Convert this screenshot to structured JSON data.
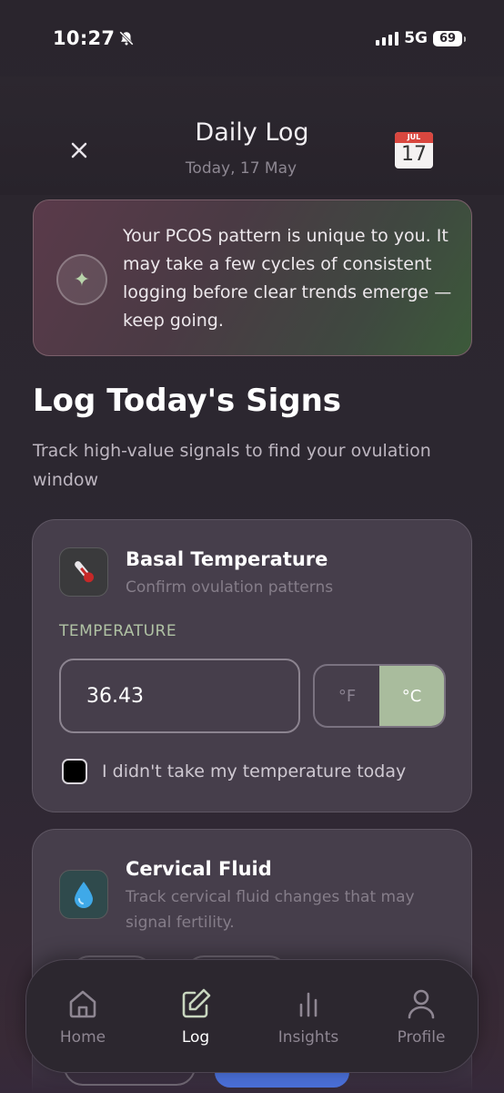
{
  "status_bar": {
    "time": "10:27",
    "network": "5G",
    "battery": "69"
  },
  "header": {
    "title": "Daily Log",
    "subtitle": "Today, 17 May",
    "calendar_month": "JUL",
    "calendar_day": "17"
  },
  "banner": {
    "text": "Your PCOS pattern is unique to you. It may take a few cycles of consistent logging before clear trends emerge — keep going."
  },
  "section": {
    "title": "Log Today's Signs",
    "description": "Track high-value signals to find your ovulation window"
  },
  "temperature_card": {
    "title": "Basal Temperature",
    "subtitle": "Confirm ovulation patterns",
    "field_label": "TEMPERATURE",
    "value": "36.43",
    "unit_f": "°F",
    "unit_c": "°C",
    "selected_unit": "°C",
    "skip_label": "I didn't take my temperature today",
    "skip_checked": false
  },
  "fluid_card": {
    "title": "Cervical Fluid",
    "subtitle": "Track cervical fluid changes that may signal fertility."
  },
  "nav": {
    "items": [
      {
        "label": "Home",
        "icon": "home-icon",
        "active": false
      },
      {
        "label": "Log",
        "icon": "edit-icon",
        "active": true
      },
      {
        "label": "Insights",
        "icon": "bar-chart-icon",
        "active": false
      },
      {
        "label": "Profile",
        "icon": "person-icon",
        "active": false
      }
    ]
  },
  "colors": {
    "accent_green": "#a9bc9d",
    "card_bg": "#463e4b",
    "background": "#2a252d"
  }
}
